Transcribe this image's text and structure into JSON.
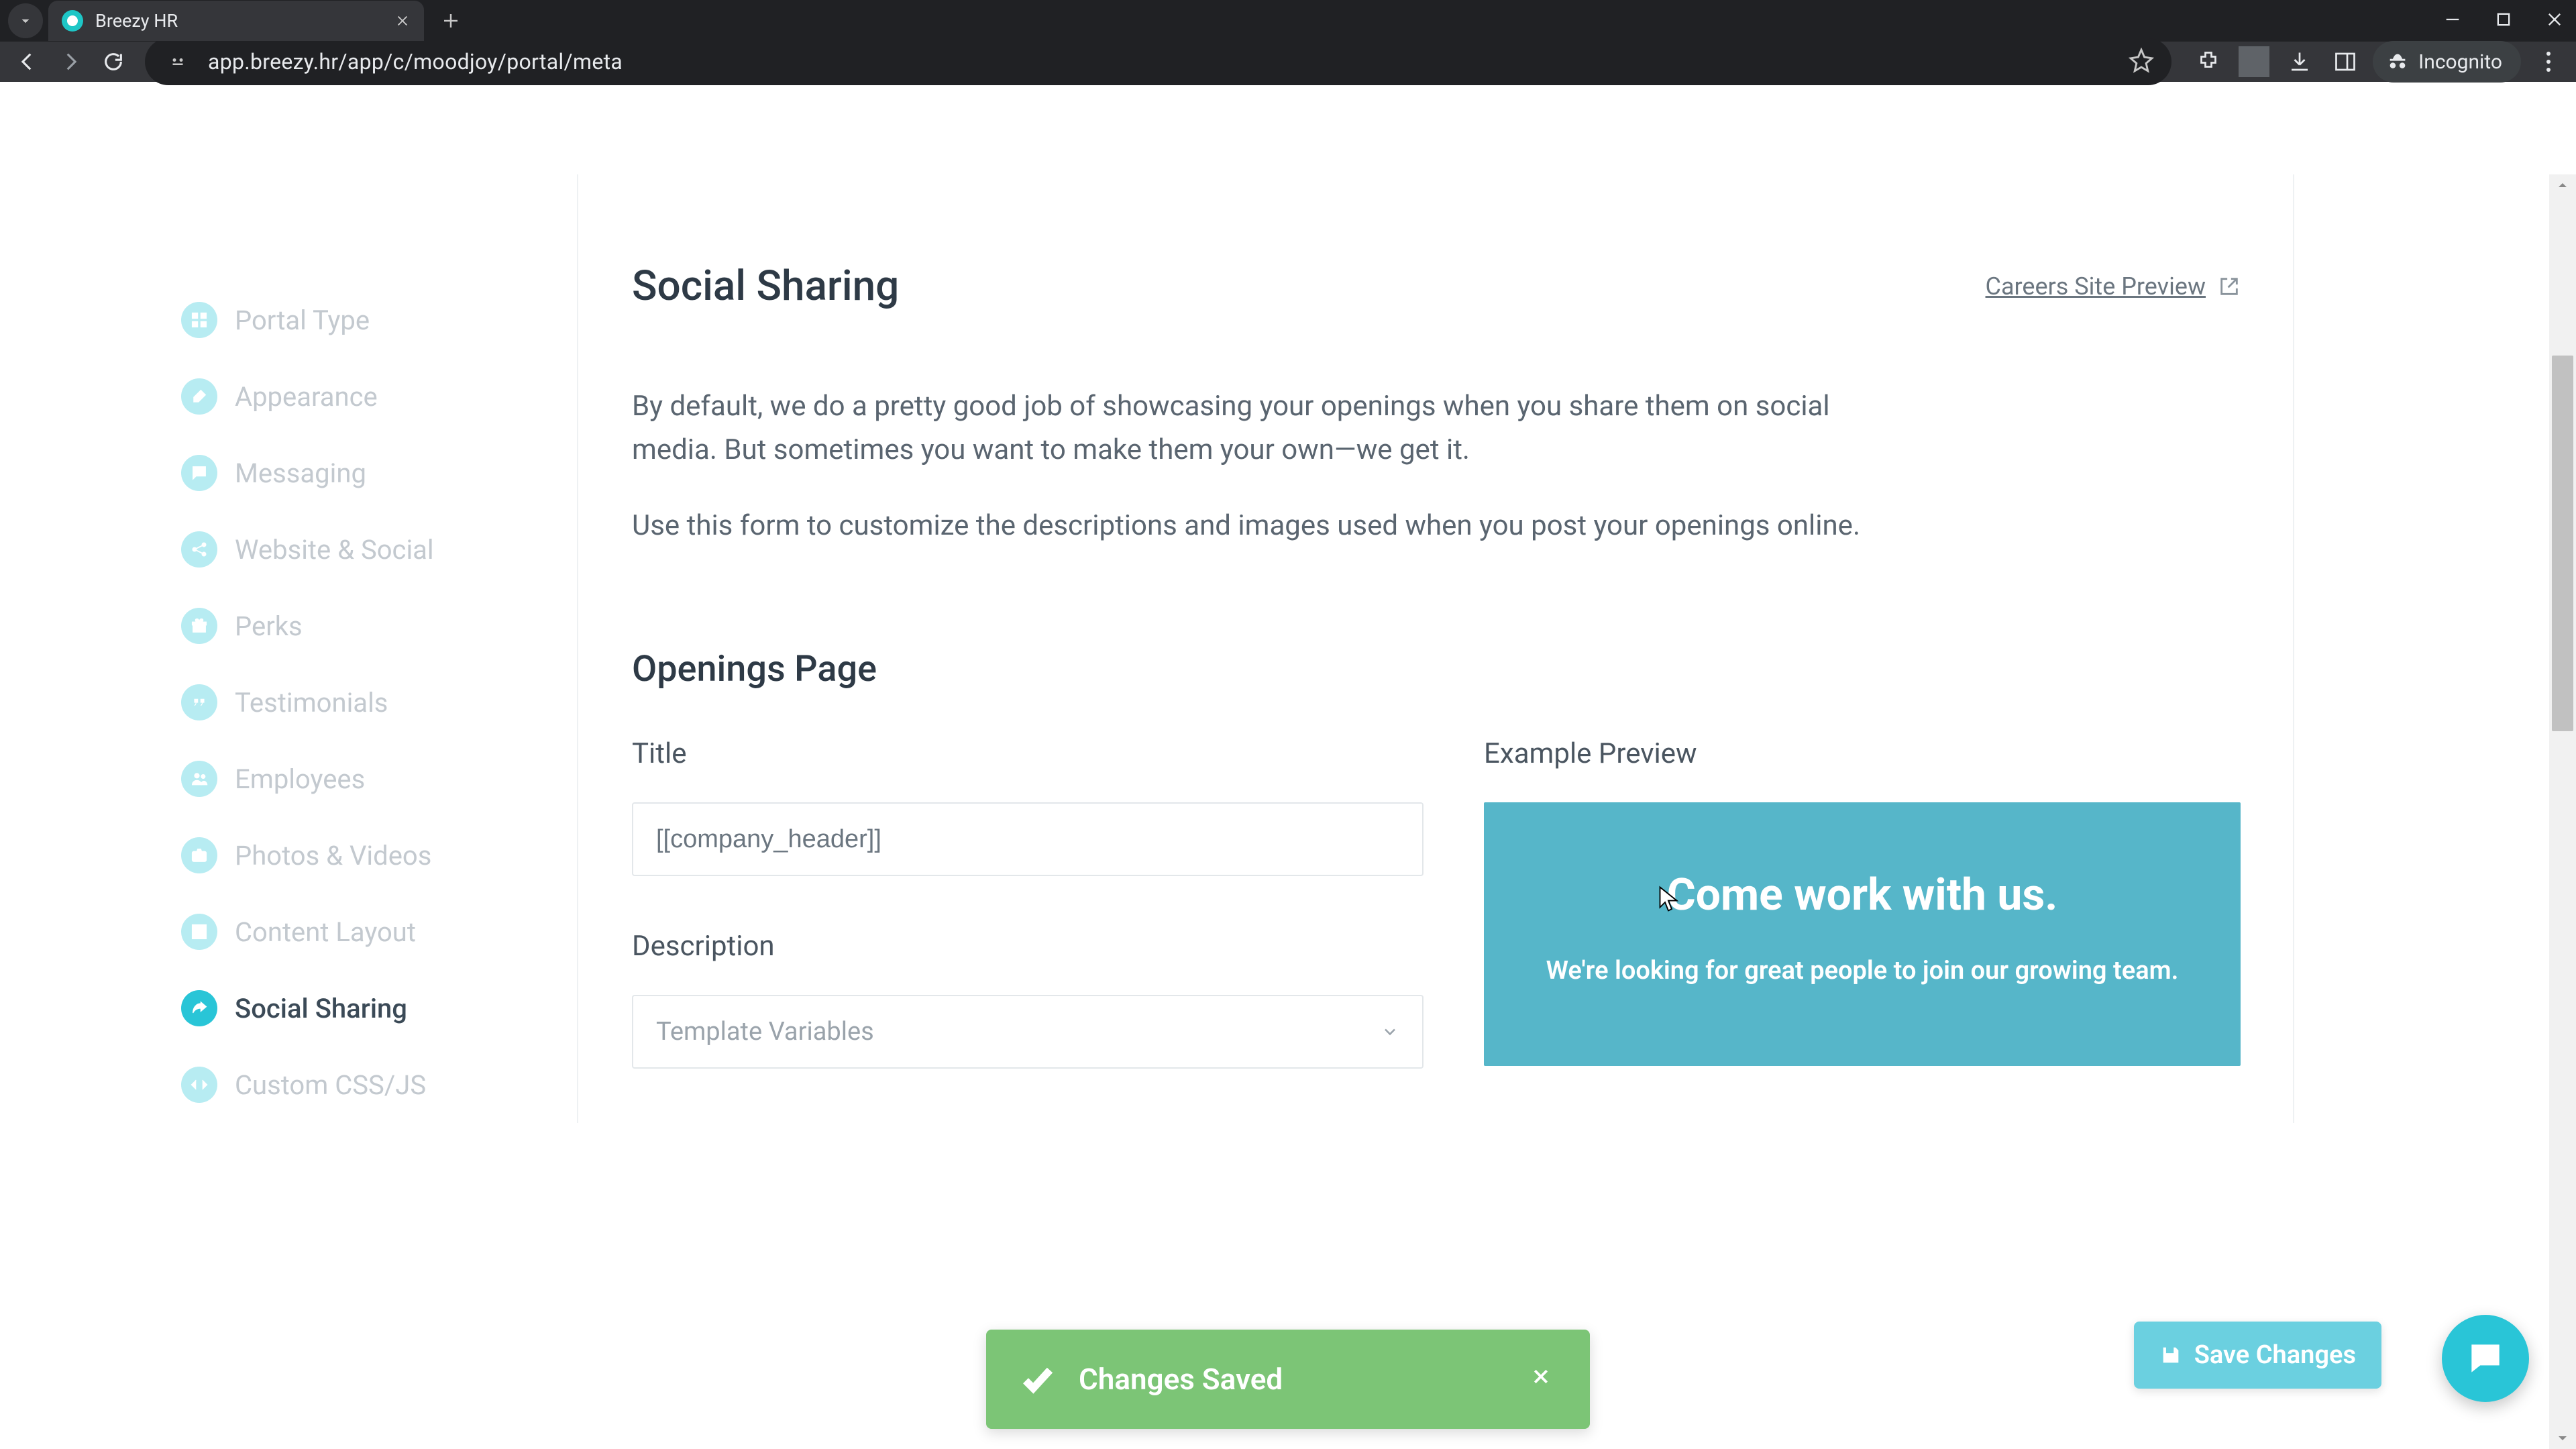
{
  "browser": {
    "tab_title": "Breezy HR",
    "url": "app.breezy.hr/app/c/moodjoy/portal/meta",
    "incognito_label": "Incognito"
  },
  "sidebar": {
    "items": [
      {
        "label": "Portal Type",
        "icon": "grid"
      },
      {
        "label": "Appearance",
        "icon": "brush"
      },
      {
        "label": "Messaging",
        "icon": "message"
      },
      {
        "label": "Website & Social",
        "icon": "share"
      },
      {
        "label": "Perks",
        "icon": "gift"
      },
      {
        "label": "Testimonials",
        "icon": "quote"
      },
      {
        "label": "Employees",
        "icon": "users"
      },
      {
        "label": "Photos & Videos",
        "icon": "camera"
      },
      {
        "label": "Content Layout",
        "icon": "layout"
      },
      {
        "label": "Social Sharing",
        "icon": "share-arrow"
      },
      {
        "label": "Custom CSS/JS",
        "icon": "code"
      }
    ],
    "active_index": 9
  },
  "page": {
    "title": "Social Sharing",
    "preview_link": "Careers Site Preview",
    "intro_p1": "By default, we do a pretty good job of showcasing your openings when you share them on social media. But sometimes you want to make them your own—we get it.",
    "intro_p2": "Use this form to customize the descriptions and images used when you post your openings online.",
    "section_title": "Openings Page",
    "title_label": "Title",
    "title_value": "[[company_header]]",
    "description_label": "Description",
    "description_dropdown": "Template Variables",
    "example_label": "Example Preview",
    "preview_heading": "Come work with us.",
    "preview_sub": "We're looking for great people to join our growing team."
  },
  "toast": {
    "text": "Changes Saved"
  },
  "actions": {
    "save": "Save Changes"
  }
}
